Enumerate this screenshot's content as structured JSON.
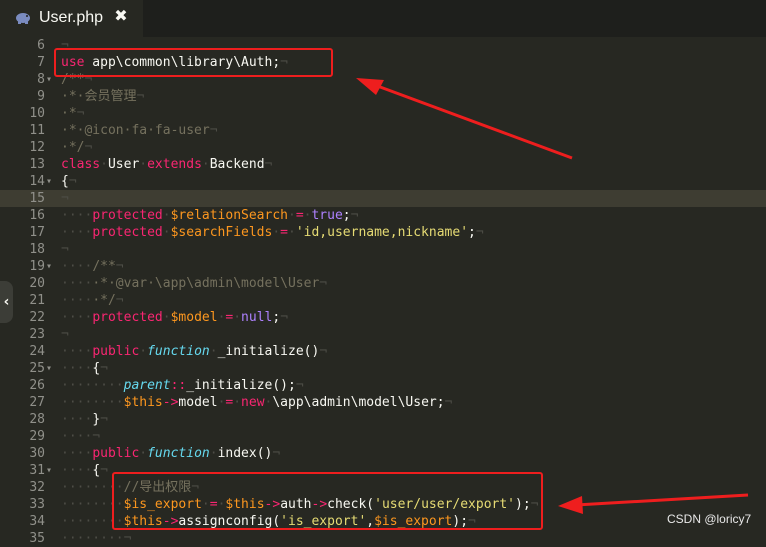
{
  "tab": {
    "title": "User.php",
    "close_glyph": "✖",
    "icon": "php-elephant-icon"
  },
  "side_toggle": {
    "glyph": "‹"
  },
  "watermark": "CSDN @loricy7",
  "colors": {
    "background": "#272822",
    "highlight_box": "#ee1e1e",
    "keyword": "#f92672",
    "storage": "#66d9ef",
    "variable": "#fd971f",
    "string": "#e6db74",
    "constant": "#ae81ff",
    "comment": "#75715e"
  },
  "lines": [
    {
      "n": "6",
      "fold": "",
      "tokens": [
        [
          "ws",
          "¬"
        ]
      ]
    },
    {
      "n": "7",
      "fold": "",
      "tokens": [
        [
          "kw",
          "use"
        ],
        [
          "txt",
          " app\\common\\library\\Auth;"
        ],
        [
          "ws",
          "¬"
        ]
      ]
    },
    {
      "n": "8",
      "fold": "▾",
      "tokens": [
        [
          "cmt",
          "/**"
        ],
        [
          "ws",
          "¬"
        ]
      ]
    },
    {
      "n": "9",
      "fold": "",
      "tokens": [
        [
          "cmt",
          "·*·会员管理"
        ],
        [
          "ws",
          "¬"
        ]
      ]
    },
    {
      "n": "10",
      "fold": "",
      "tokens": [
        [
          "cmt",
          "·*"
        ],
        [
          "ws",
          "¬"
        ]
      ]
    },
    {
      "n": "11",
      "fold": "",
      "tokens": [
        [
          "cmt",
          "·*·@icon·fa·fa-user"
        ],
        [
          "ws",
          "¬"
        ]
      ]
    },
    {
      "n": "12",
      "fold": "",
      "tokens": [
        [
          "cmt",
          "·*/"
        ],
        [
          "ws",
          "¬"
        ]
      ]
    },
    {
      "n": "13",
      "fold": "",
      "tokens": [
        [
          "kw",
          "class"
        ],
        [
          "ws",
          "·"
        ],
        [
          "txt",
          "User"
        ],
        [
          "ws",
          "·"
        ],
        [
          "kw",
          "extends"
        ],
        [
          "ws",
          "·"
        ],
        [
          "txt",
          "Backend"
        ],
        [
          "ws",
          "¬"
        ]
      ]
    },
    {
      "n": "14",
      "fold": "▾",
      "tokens": [
        [
          "txt",
          "{"
        ],
        [
          "ws",
          "¬"
        ]
      ]
    },
    {
      "n": "15",
      "fold": "",
      "tokens": [
        [
          "ws",
          "¬"
        ]
      ],
      "active": true
    },
    {
      "n": "16",
      "fold": "",
      "tokens": [
        [
          "ws",
          "····"
        ],
        [
          "kw",
          "protected"
        ],
        [
          "ws",
          "·"
        ],
        [
          "var",
          "$relationSearch"
        ],
        [
          "ws",
          "·"
        ],
        [
          "kw",
          "="
        ],
        [
          "ws",
          "·"
        ],
        [
          "cons",
          "true"
        ],
        [
          "txt",
          ";"
        ],
        [
          "ws",
          "¬"
        ]
      ]
    },
    {
      "n": "17",
      "fold": "",
      "tokens": [
        [
          "ws",
          "····"
        ],
        [
          "kw",
          "protected"
        ],
        [
          "ws",
          "·"
        ],
        [
          "var",
          "$searchFields"
        ],
        [
          "ws",
          "·"
        ],
        [
          "kw",
          "="
        ],
        [
          "ws",
          "·"
        ],
        [
          "str",
          "'id,username,nickname'"
        ],
        [
          "txt",
          ";"
        ],
        [
          "ws",
          "¬"
        ]
      ]
    },
    {
      "n": "18",
      "fold": "",
      "tokens": [
        [
          "ws",
          "¬"
        ]
      ]
    },
    {
      "n": "19",
      "fold": "▾",
      "tokens": [
        [
          "ws",
          "····"
        ],
        [
          "cmt",
          "/**"
        ],
        [
          "ws",
          "¬"
        ]
      ]
    },
    {
      "n": "20",
      "fold": "",
      "tokens": [
        [
          "ws",
          "····"
        ],
        [
          "cmt",
          "·*·@var·\\app\\admin\\model\\User"
        ],
        [
          "ws",
          "¬"
        ]
      ]
    },
    {
      "n": "21",
      "fold": "",
      "tokens": [
        [
          "ws",
          "····"
        ],
        [
          "cmt",
          "·*/"
        ],
        [
          "ws",
          "¬"
        ]
      ]
    },
    {
      "n": "22",
      "fold": "",
      "tokens": [
        [
          "ws",
          "····"
        ],
        [
          "kw",
          "protected"
        ],
        [
          "ws",
          "·"
        ],
        [
          "var",
          "$model"
        ],
        [
          "ws",
          "·"
        ],
        [
          "kw",
          "="
        ],
        [
          "ws",
          "·"
        ],
        [
          "cons",
          "null"
        ],
        [
          "txt",
          ";"
        ],
        [
          "ws",
          "¬"
        ]
      ]
    },
    {
      "n": "23",
      "fold": "",
      "tokens": [
        [
          "ws",
          "¬"
        ]
      ]
    },
    {
      "n": "24",
      "fold": "",
      "tokens": [
        [
          "ws",
          "····"
        ],
        [
          "kw",
          "public"
        ],
        [
          "ws",
          "·"
        ],
        [
          "st",
          "function"
        ],
        [
          "ws",
          "·"
        ],
        [
          "fn",
          "_initialize()"
        ],
        [
          "ws",
          "¬"
        ]
      ]
    },
    {
      "n": "25",
      "fold": "▾",
      "tokens": [
        [
          "ws",
          "····"
        ],
        [
          "txt",
          "{"
        ],
        [
          "ws",
          "¬"
        ]
      ]
    },
    {
      "n": "26",
      "fold": "",
      "tokens": [
        [
          "ws",
          "········"
        ],
        [
          "st",
          "parent"
        ],
        [
          "kw",
          "::"
        ],
        [
          "txt",
          "_initialize();"
        ],
        [
          "ws",
          "¬"
        ]
      ]
    },
    {
      "n": "27",
      "fold": "",
      "tokens": [
        [
          "ws",
          "········"
        ],
        [
          "var",
          "$this"
        ],
        [
          "kw",
          "->"
        ],
        [
          "txt",
          "model"
        ],
        [
          "ws",
          "·"
        ],
        [
          "kw",
          "="
        ],
        [
          "ws",
          "·"
        ],
        [
          "kw",
          "new"
        ],
        [
          "ws",
          "·"
        ],
        [
          "txt",
          "\\app\\admin\\model\\User;"
        ],
        [
          "ws",
          "¬"
        ]
      ]
    },
    {
      "n": "28",
      "fold": "",
      "tokens": [
        [
          "ws",
          "····"
        ],
        [
          "txt",
          "}"
        ],
        [
          "ws",
          "¬"
        ]
      ]
    },
    {
      "n": "29",
      "fold": "",
      "tokens": [
        [
          "ws",
          "····¬"
        ]
      ]
    },
    {
      "n": "30",
      "fold": "",
      "tokens": [
        [
          "ws",
          "····"
        ],
        [
          "kw",
          "public"
        ],
        [
          "ws",
          "·"
        ],
        [
          "st",
          "function"
        ],
        [
          "ws",
          "·"
        ],
        [
          "fn",
          "index()"
        ],
        [
          "ws",
          "¬"
        ]
      ]
    },
    {
      "n": "31",
      "fold": "▾",
      "tokens": [
        [
          "ws",
          "····"
        ],
        [
          "txt",
          "{"
        ],
        [
          "ws",
          "¬"
        ]
      ]
    },
    {
      "n": "32",
      "fold": "",
      "tokens": [
        [
          "ws",
          "········"
        ],
        [
          "cmt",
          "//导出权限"
        ],
        [
          "ws",
          "¬"
        ]
      ]
    },
    {
      "n": "33",
      "fold": "",
      "tokens": [
        [
          "ws",
          "········"
        ],
        [
          "var",
          "$is_export"
        ],
        [
          "ws",
          "·"
        ],
        [
          "kw",
          "="
        ],
        [
          "ws",
          "·"
        ],
        [
          "var",
          "$this"
        ],
        [
          "kw",
          "->"
        ],
        [
          "txt",
          "auth"
        ],
        [
          "kw",
          "->"
        ],
        [
          "txt",
          "check("
        ],
        [
          "str",
          "'user/user/export'"
        ],
        [
          "txt",
          ");"
        ],
        [
          "ws",
          "¬"
        ]
      ]
    },
    {
      "n": "34",
      "fold": "",
      "tokens": [
        [
          "ws",
          "········"
        ],
        [
          "var",
          "$this"
        ],
        [
          "kw",
          "->"
        ],
        [
          "txt",
          "assignconfig("
        ],
        [
          "str",
          "'is_export'"
        ],
        [
          "txt",
          ","
        ],
        [
          "var",
          "$is_export"
        ],
        [
          "txt",
          ");"
        ],
        [
          "ws",
          "¬"
        ]
      ]
    },
    {
      "n": "35",
      "fold": "",
      "tokens": [
        [
          "ws",
          "········¬"
        ]
      ]
    }
  ]
}
